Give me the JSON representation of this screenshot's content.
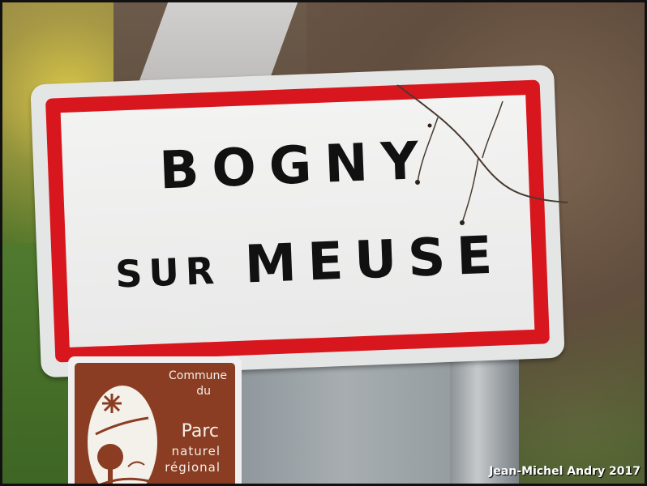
{
  "sign": {
    "line1": "BOGNY",
    "line2_small": "SUR",
    "line2_large": "MEUSE",
    "border_color": "#d8161d",
    "background_color": "#f0f0f0"
  },
  "park_sign": {
    "commune": "Commune",
    "du": "du",
    "parc": "Parc",
    "naturel": "naturel",
    "regional": "régional",
    "background_color": "#8a3d23",
    "logo_icon": "park-tree-logo-icon"
  },
  "credit": "Jean-Michel Andry 2017"
}
